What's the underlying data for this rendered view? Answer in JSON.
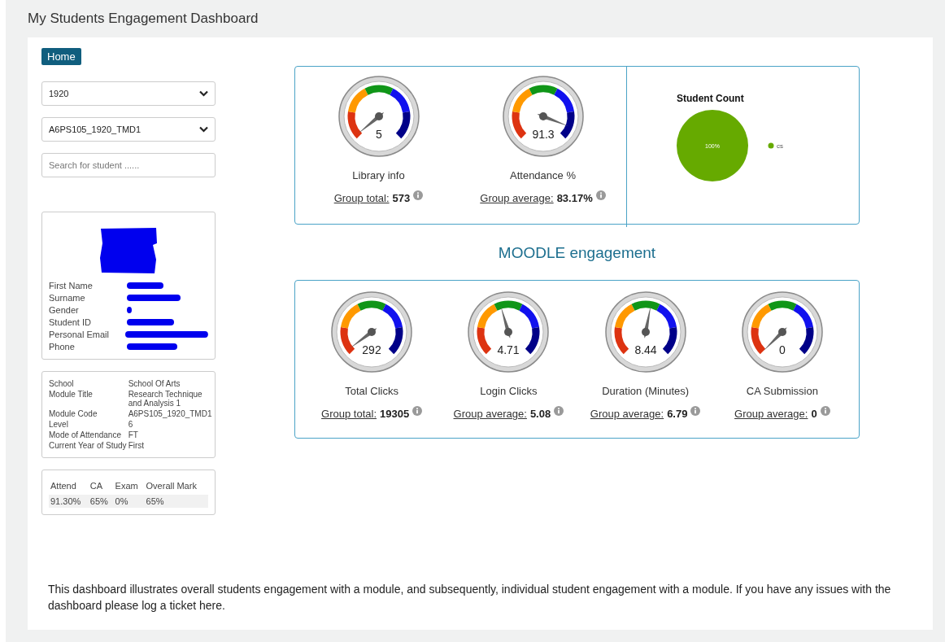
{
  "page_title": "My Students Engagement Dashboard",
  "home_button": "Home",
  "filters": [
    {
      "value": "1920"
    },
    {
      "value": "A6PS105_1920_TMD1"
    }
  ],
  "search": {
    "placeholder": "Search for student ......"
  },
  "student": {
    "photo_redacted": true,
    "fields": [
      {
        "label": "First Name",
        "redacted": true
      },
      {
        "label": "Surname",
        "redacted": true
      },
      {
        "label": "Gender",
        "redacted": true
      },
      {
        "label": "Student ID",
        "redacted": true
      },
      {
        "label": "Personal Email",
        "redacted": true
      },
      {
        "label": "Phone",
        "redacted": true
      }
    ]
  },
  "module": [
    {
      "label": "School",
      "value": "School Of Arts"
    },
    {
      "label": "Module Title",
      "value": "Research Technique and Analysis 1"
    },
    {
      "label": "Module Code",
      "value": "A6PS105_1920_TMD1"
    },
    {
      "label": "Level",
      "value": "6"
    },
    {
      "label": "Mode of Attendance",
      "value": "FT"
    },
    {
      "label": "Current Year of Study",
      "value": "First"
    }
  ],
  "marks": {
    "columns": [
      "Attend",
      "CA",
      "Exam",
      "Overall Mark"
    ],
    "rows": [
      [
        "91.30%",
        "65%",
        "0%",
        "65%"
      ]
    ]
  },
  "top_gauges": [
    {
      "value": "5",
      "label": "Library info",
      "group_label": "Group total:",
      "group_value": "573"
    },
    {
      "value": "91.3",
      "label": "Attendance %",
      "group_label": "Group average:",
      "group_value": "83.17%"
    }
  ],
  "student_count": {
    "chart_data": {
      "type": "pie",
      "title": "Student Count",
      "series": [
        {
          "name": "cs",
          "color": "#66aa00",
          "values": [
            100
          ]
        }
      ],
      "value_labels": [
        "100%"
      ]
    }
  },
  "moodle_heading": "MOODLE engagement",
  "moodle_gauges": [
    {
      "value": "292",
      "label": "Total Clicks",
      "group_label": "Group total:",
      "group_value": "19305"
    },
    {
      "value": "4.71",
      "label": "Login Clicks",
      "group_label": "Group average:",
      "group_value": "5.08"
    },
    {
      "value": "8.44",
      "label": "Duration (Minutes)",
      "group_label": "Group average:",
      "group_value": "6.79"
    },
    {
      "value": "0",
      "label": "CA Submission",
      "group_label": "Group average:",
      "group_value": "0"
    }
  ],
  "footer": "This dashboard illustrates overall students engagement with a module, and subsequently, individual student engagement with a module. If you have any issues with the dashboard please log a ticket here."
}
